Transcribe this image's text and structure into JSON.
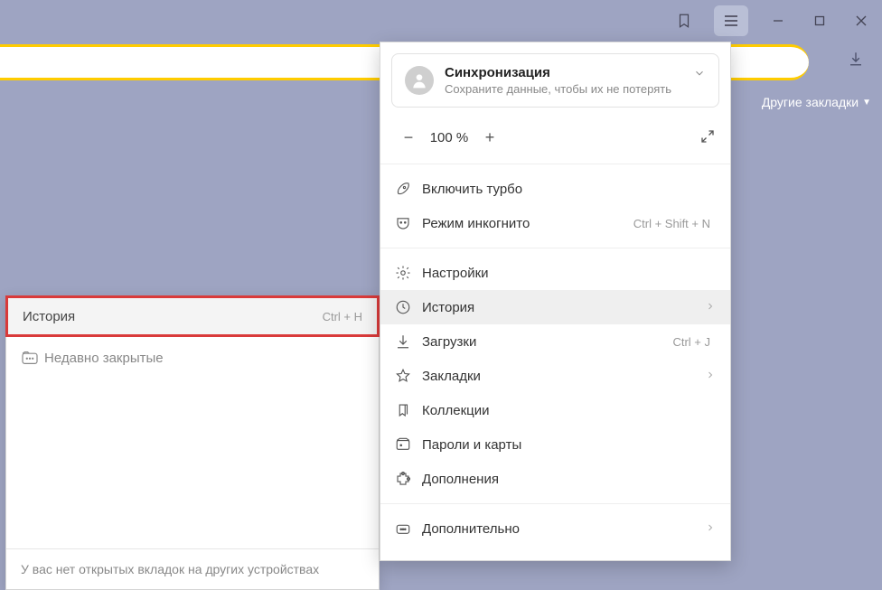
{
  "titlebar": {
    "bookmark_icon": "bookmark-outline",
    "menu_icon": "hamburger",
    "minimize_icon": "minimize",
    "maximize_icon": "maximize",
    "close_icon": "close"
  },
  "toolbar": {
    "download_icon": "download"
  },
  "other_bookmarks_label": "Другие закладки",
  "submenu": {
    "history_label": "История",
    "history_shortcut": "Ctrl + H",
    "recent_label": "Недавно закрытые",
    "footer_text": "У вас нет открытых вкладок на других устройствах"
  },
  "sync": {
    "title": "Синхронизация",
    "subtitle": "Сохраните данные, чтобы их не потерять"
  },
  "zoom": {
    "minus": "−",
    "value": "100 %",
    "plus": "+"
  },
  "menu": {
    "turbo": "Включить турбо",
    "incognito": "Режим инкогнито",
    "incognito_shortcut": "Ctrl + Shift + N",
    "settings": "Настройки",
    "history": "История",
    "downloads": "Загрузки",
    "downloads_shortcut": "Ctrl + J",
    "bookmarks": "Закладки",
    "collections": "Коллекции",
    "passwords": "Пароли и карты",
    "addons": "Дополнения",
    "more": "Дополнительно"
  }
}
